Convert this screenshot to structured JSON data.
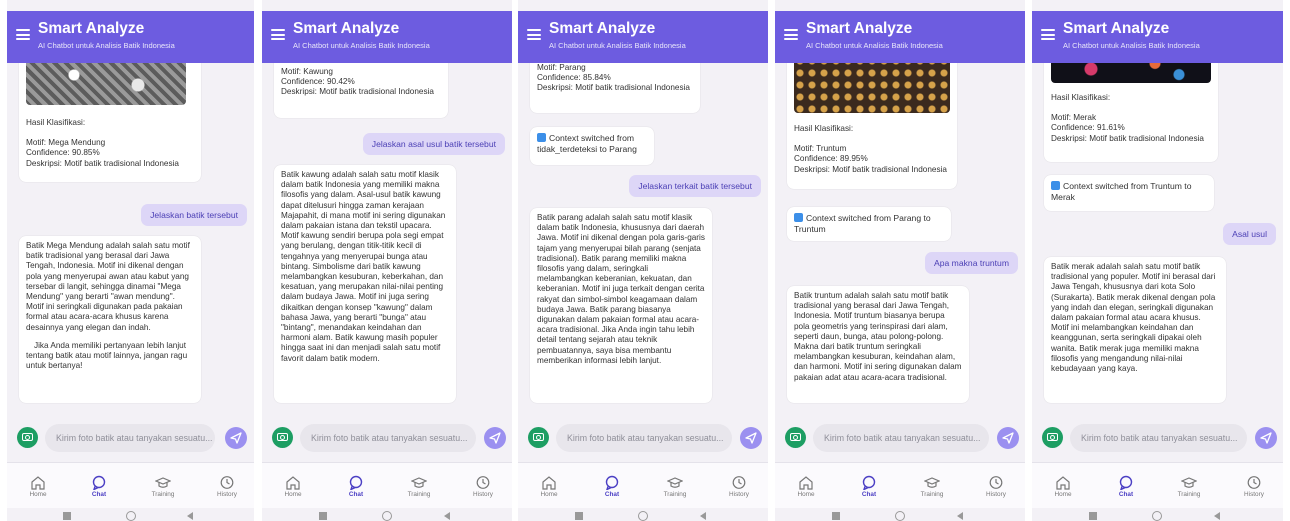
{
  "app": {
    "title": "Smart Analyze",
    "subtitle": "AI Chatbot untuk Analisis Batik Indonesia",
    "accent_color": "#6d5ce0",
    "icons": [
      "menu-icon",
      "camera-icon",
      "send-icon",
      "home-icon",
      "chat-icon",
      "training-icon",
      "history-icon"
    ]
  },
  "composer": {
    "placeholder": "Kirim foto batik atau tanyakan sesuatu..."
  },
  "nav": {
    "home": "Home",
    "chat": "Chat",
    "training": "Training",
    "history": "History"
  },
  "screens": [
    {
      "result": {
        "heading": "Hasil Klasifikasi:",
        "motif": "Motif: Mega Mendung",
        "confidence": "Confidence: 90.85%",
        "description": "Deskripsi: Motif batik tradisional Indonesia"
      },
      "user_message": "Jelaskan batik tersebut",
      "reply": "Batik Mega Mendung adalah salah satu motif batik tradisional yang berasal dari Jawa Tengah, Indonesia. Motif ini dikenal dengan pola yang menyerupai awan atau kabut yang tersebar di langit, sehingga dinamai \"Mega Mendung\" yang berarti \"awan mendung\". Motif ini seringkali digunakan pada pakaian formal atau acara-acara khusus karena desainnya yang elegan dan indah.",
      "reply_followup": "Jika Anda memiliki pertanyaan lebih lanjut tentang batik atau motif lainnya, jangan ragu untuk bertanya!"
    },
    {
      "result": {
        "motif": "Motif: Kawung",
        "confidence": "Confidence: 90.42%",
        "description": "Deskripsi: Motif batik tradisional Indonesia"
      },
      "user_message": "Jelaskan asal usul batik tersebut",
      "reply": "Batik kawung adalah salah satu motif klasik dalam batik Indonesia yang memiliki makna filosofis yang dalam. Asal-usul batik kawung dapat ditelusuri hingga zaman kerajaan Majapahit, di mana motif ini sering digunakan dalam pakaian istana dan tekstil upacara. Motif kawung sendiri berupa pola segi empat yang berulang, dengan titik-titik kecil di tengahnya yang menyerupai bunga atau bintang. Simbolisme dari batik kawung melambangkan kesuburan, keberkahan, dan kesatuan, yang merupakan nilai-nilai penting dalam budaya Jawa. Motif ini juga sering dikaitkan dengan konsep \"kawung\" dalam bahasa Jawa, yang berarti \"bunga\" atau \"bintang\", menandakan keindahan dan harmoni alam. Batik kawung masih populer hingga saat ini dan menjadi salah satu motif favorit dalam batik modern."
    },
    {
      "result": {
        "motif": "Motif: Parang",
        "confidence": "Confidence: 85.84%",
        "description": "Deskripsi: Motif batik tradisional Indonesia"
      },
      "context": "Context switched from tidak_terdeteksi to Parang",
      "user_message": "Jelaskan terkait batik tersebut",
      "reply": "Batik parang adalah salah satu motif klasik dalam batik Indonesia, khususnya dari daerah Jawa. Motif ini dikenal dengan pola garis-garis tajam yang menyerupai bilah parang (senjata tradisional). Batik parang memiliki makna filosofis yang dalam, seringkali melambangkan keberanian, kekuatan, dan keberanian. Motif ini juga terkait dengan cerita rakyat dan simbol-simbol keagamaan dalam budaya Jawa. Batik parang biasanya digunakan dalam pakaian formal atau acara-acara tradisional. Jika Anda ingin tahu lebih detail tentang sejarah atau teknik pembuatannya, saya bisa membantu memberikan informasi lebih lanjut."
    },
    {
      "result": {
        "heading": "Hasil Klasifikasi:",
        "motif": "Motif: Truntum",
        "confidence": "Confidence: 89.95%",
        "description": "Deskripsi: Motif batik tradisional Indonesia"
      },
      "context": "Context switched from Parang to Truntum",
      "user_message": "Apa makna truntum",
      "reply": "Batik truntum adalah salah satu motif batik tradisional yang berasal dari Jawa Tengah, Indonesia. Motif truntum biasanya berupa pola geometris yang terinspirasi dari alam, seperti daun, bunga, atau polong-polong. Makna dari batik truntum seringkali melambangkan kesuburan, keindahan alam, dan harmoni. Motif ini sering digunakan dalam pakaian adat atau acara-acara tradisional."
    },
    {
      "result": {
        "heading": "Hasil Klasifikasi:",
        "motif": "Motif: Merak",
        "confidence": "Confidence: 91.61%",
        "description": "Deskripsi: Motif batik tradisional Indonesia"
      },
      "context": "Context switched from Truntum to Merak",
      "user_message": "Asal usul",
      "reply": "Batik merak adalah salah satu motif batik tradisional yang populer. Motif ini berasal dari Jawa Tengah, khususnya dari kota Solo (Surakarta). Batik merak dikenal dengan pola yang indah dan elegan, seringkali digunakan dalam pakaian formal atau acara khusus. Motif ini melambangkan keindahan dan keanggunan, serta seringkali dipakai oleh wanita. Batik merak juga memiliki makna filosofis yang mengandung nilai-nilai kebudayaan yang kaya."
    }
  ]
}
